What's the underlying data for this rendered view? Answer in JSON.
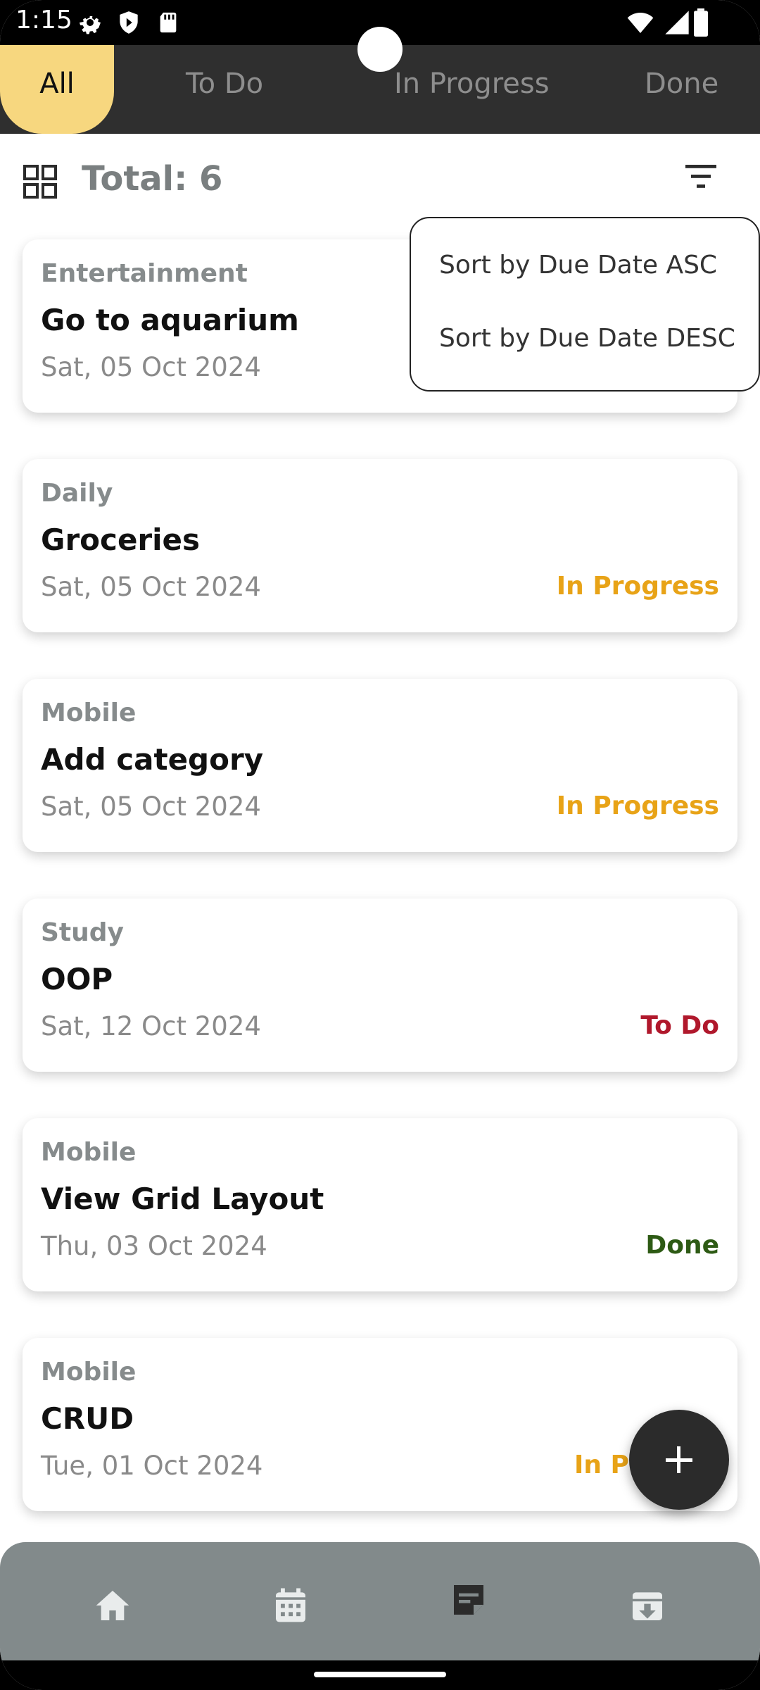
{
  "status_bar": {
    "time": "1:15"
  },
  "tabs": [
    {
      "label": "All",
      "active": true
    },
    {
      "label": "To Do",
      "active": false
    },
    {
      "label": "In Progress",
      "active": false
    },
    {
      "label": "Done",
      "active": false
    }
  ],
  "header": {
    "total_label": "Total: 6"
  },
  "sort_menu": {
    "items": [
      {
        "label": "Sort by Due Date ASC"
      },
      {
        "label": "Sort by Due Date DESC"
      }
    ]
  },
  "tasks": [
    {
      "category": "Entertainment",
      "title": "Go to aquarium",
      "date": "Sat, 05 Oct 2024",
      "status": ""
    },
    {
      "category": "Daily",
      "title": "Groceries",
      "date": "Sat, 05 Oct 2024",
      "status": "In Progress"
    },
    {
      "category": "Mobile",
      "title": "Add category",
      "date": "Sat, 05 Oct 2024",
      "status": "In Progress"
    },
    {
      "category": "Study",
      "title": "OOP",
      "date": "Sat, 12 Oct 2024",
      "status": "To Do"
    },
    {
      "category": "Mobile",
      "title": "View Grid Layout",
      "date": "Thu, 03 Oct 2024",
      "status": "Done"
    },
    {
      "category": "Mobile",
      "title": "CRUD",
      "date": "Tue, 01 Oct 2024",
      "status": "In Pr"
    }
  ],
  "status_colors": {
    "In Progress": "#e8a317",
    "To Do": "#b0182c",
    "Done": "#2d5a14",
    "In Pr": "#e8a317"
  },
  "accent": "#f7d77f",
  "bottom_nav": [
    {
      "icon": "home-icon"
    },
    {
      "icon": "calendar-icon"
    },
    {
      "icon": "notes-icon",
      "active": true
    },
    {
      "icon": "archive-icon"
    }
  ]
}
